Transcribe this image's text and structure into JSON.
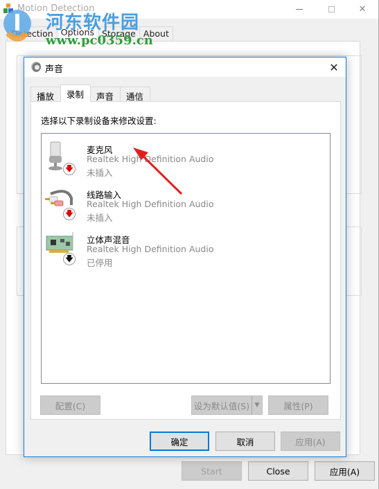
{
  "main_window": {
    "title": "Motion Detection",
    "tabs": [
      {
        "label": "Detection",
        "active": false
      },
      {
        "label": "Options",
        "active": true
      },
      {
        "label": "Storage",
        "active": false
      },
      {
        "label": "About",
        "active": false
      }
    ],
    "buttons": {
      "start": "Start",
      "close": "Close",
      "apply": "应用(A)"
    }
  },
  "watermark": {
    "site_name": "河东软件园",
    "url": "www.pc0359.cn",
    "colors": {
      "text": "#4a9ee0",
      "url": "#2f9e3a",
      "logo": "#f0a040"
    }
  },
  "sound_dialog": {
    "title": "声音",
    "tabs": [
      {
        "label": "播放",
        "active": false
      },
      {
        "label": "录制",
        "active": true
      },
      {
        "label": "声音",
        "active": false
      },
      {
        "label": "通信",
        "active": false
      }
    ],
    "instruction": "选择以下录制设备来修改设置:",
    "devices": [
      {
        "name": "麦克风",
        "driver": "Realtek High Definition Audio",
        "status": "未插入",
        "icon": "microphone-icon",
        "badge": "unplugged-red-arrow"
      },
      {
        "name": "线路输入",
        "driver": "Realtek High Definition Audio",
        "status": "未插入",
        "icon": "line-in-cable-icon",
        "badge": "unplugged-red-arrow"
      },
      {
        "name": "立体声混音",
        "driver": "Realtek High Definition Audio",
        "status": "已停用",
        "icon": "sound-card-icon",
        "badge": "disabled-black-arrow"
      }
    ],
    "panel_buttons": {
      "configure": "配置(C)",
      "set_default": "设为默认值(S)",
      "properties": "属性(P)"
    },
    "dialog_buttons": {
      "ok": "确定",
      "cancel": "取消",
      "apply": "应用(A)"
    },
    "close_glyph": "✕"
  },
  "annotation": {
    "arrow_color": "#e02020"
  },
  "icons": {
    "down_arrow": "🡇",
    "dropdown_caret": "▼"
  }
}
